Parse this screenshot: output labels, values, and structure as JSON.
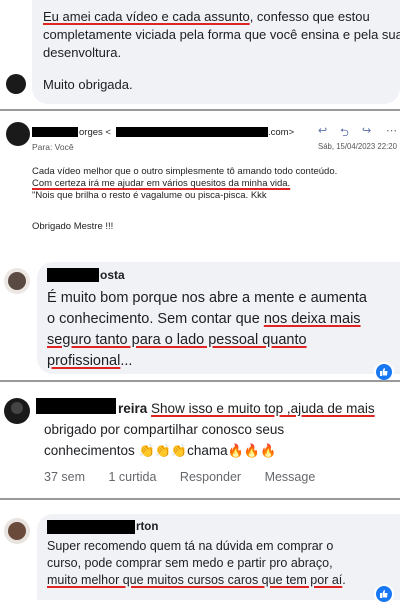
{
  "comment1": {
    "line1_underlined": "Eu amei cada vídeo e cada assunto",
    "line1_rest": ", confesso que estou",
    "line2": "completamente viciada pela forma que você ensina e pela sua",
    "line3": "desenvoltura.",
    "line4": "Muito obrigada."
  },
  "email": {
    "from_suffix": "orges <",
    "from_end": ".com>",
    "to": "Para: Você",
    "date": "Sáb, 15/04/2023 22:20",
    "line1": "Cada vídeo melhor que o outro simplesmente tô amando todo conteúdo.",
    "line2": "Com certeza irá me ajudar em vários quesitos da minha vida.",
    "line3": "\"Nois que brilha o resto é vagalume ou pisca-pisca. Kkk",
    "line4": "Obrigado Mestre !!!"
  },
  "comment3": {
    "name_tail": "osta",
    "line1": "É muito bom porque nos abre a mente e aumenta",
    "line2a": "o conhecimento. Sem contar que ",
    "line2b": "nos deixa mais",
    "line3": "seguro tanto para o lado pessoal quanto",
    "line4a": "profissional",
    "line4b": "..."
  },
  "comment4": {
    "name_tail": "reira",
    "line1": "Show isso e muito top ,ajuda de mais",
    "line2": "obrigado por compartilhar conosco seus",
    "line3a": "conhecimentos ",
    "emojis_clap": "👏👏👏",
    "line3b": "chama",
    "emojis_fire": "🔥🔥🔥",
    "actions": {
      "time": "37 sem",
      "like": "1 curtida",
      "reply": "Responder",
      "message": "Message"
    }
  },
  "comment5": {
    "name_tail": "rton",
    "line1": "Super recomendo quem tá na dúvida em comprar o",
    "line2": "curso, pode comprar sem medo e partir pro abraço,",
    "line3": "muito melhor que muitos cursos caros que tem por aí",
    "line3_end": "."
  },
  "colors": {
    "bubble": "#f0f2f5",
    "underline": "#e02424",
    "reaction_badge": "#1877f2"
  }
}
